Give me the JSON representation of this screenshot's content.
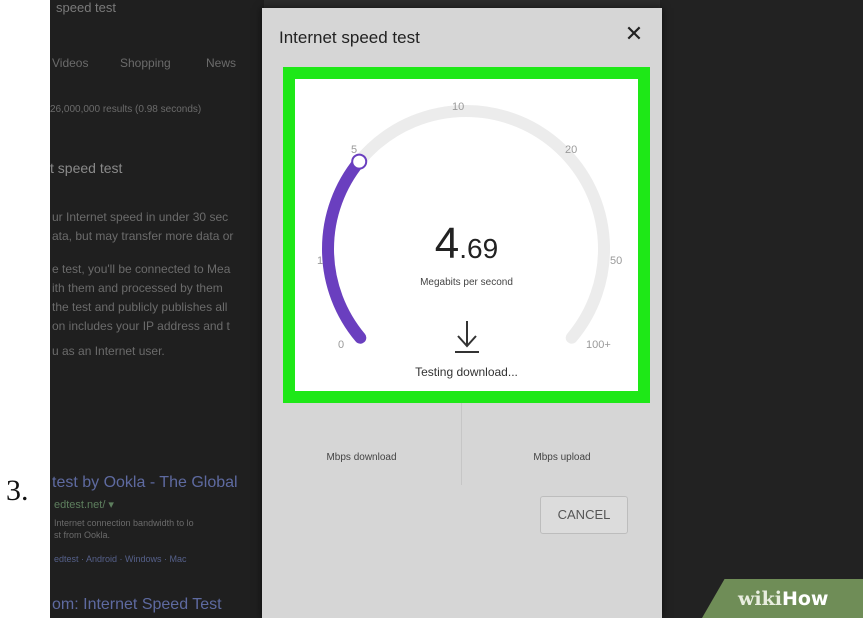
{
  "step_number": "3.",
  "background": {
    "header_text": "speed test",
    "tabs": [
      "Videos",
      "Shopping",
      "News"
    ],
    "results_count": "26,000,000 results (0.98 seconds)",
    "snippet_title": "t speed test",
    "snippet_lines": [
      "ur Internet speed in under 30 sec",
      "ata, but may transfer more data or",
      "e test, you'll be connected to Mea",
      "ith them and processed by them",
      "the test and publicly publishes all",
      "on includes your IP address and t",
      "u as an Internet user."
    ],
    "result2_title": "test by Ookla - The Global",
    "result2_url": "edtest.net/ ▾",
    "result2_lines": [
      "Internet connection bandwidth to lo",
      "st from Ookla."
    ],
    "result2_links": "edtest · Android · Windows · Mac",
    "result3_title": "om: Internet Speed Test"
  },
  "dialog": {
    "title": "Internet speed test",
    "close_icon": "close-icon",
    "gauge": {
      "ticks": [
        "0",
        "1",
        "5",
        "10",
        "20",
        "50",
        "100+"
      ],
      "speed_int": "4",
      "speed_frac": ".69",
      "unit": "Megabits per second",
      "status": "Testing download...",
      "fill_fraction": 0.305,
      "fill_color": "#6a3fbf",
      "track_color": "#ececec",
      "download_icon": "download-arrow-icon"
    },
    "highlight_color": "#1ee817",
    "results": {
      "download_label": "Mbps download",
      "upload_label": "Mbps upload"
    },
    "cancel_label": "CANCEL"
  },
  "watermark": {
    "wiki": "wiki",
    "how": "How"
  }
}
